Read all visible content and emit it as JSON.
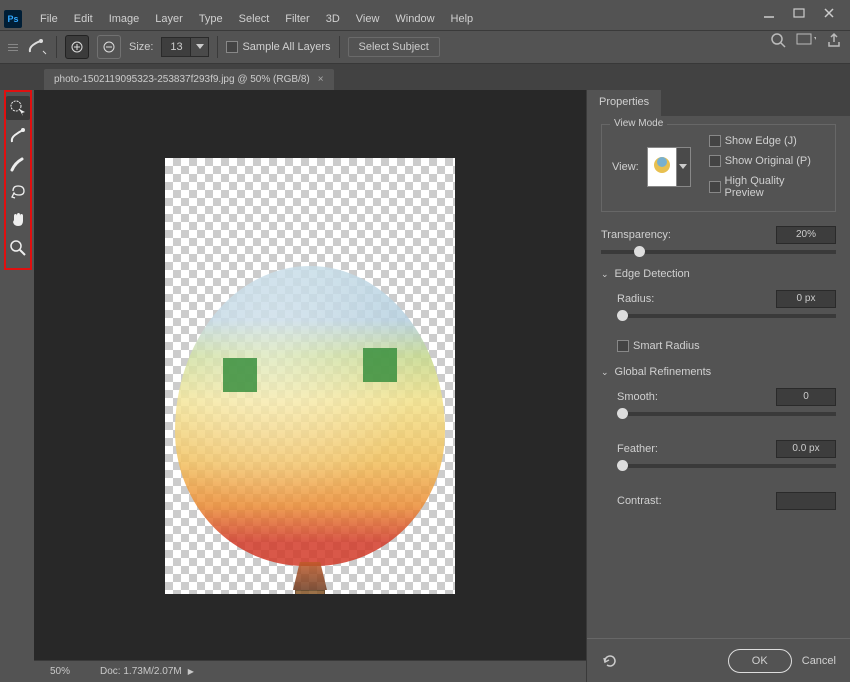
{
  "menu": [
    "File",
    "Edit",
    "Image",
    "Layer",
    "Type",
    "Select",
    "Filter",
    "3D",
    "View",
    "Window",
    "Help"
  ],
  "options": {
    "size_label": "Size:",
    "size_value": "13",
    "sample_all": "Sample All Layers",
    "select_subject": "Select Subject"
  },
  "doc_tab": {
    "title": "photo-1502119095323-253837f293f9.jpg @ 50% (RGB/8)"
  },
  "status": {
    "zoom": "50%",
    "doc_size": "Doc: 1.73M/2.07M"
  },
  "panel": {
    "title": "Properties",
    "view_mode": {
      "legend": "View Mode",
      "view_label": "View:",
      "show_edge": "Show Edge (J)",
      "show_original": "Show Original (P)",
      "high_quality": "High Quality Preview"
    },
    "transparency": {
      "label": "Transparency:",
      "value": "20%",
      "pos": "14%"
    },
    "edge_detection": {
      "title": "Edge Detection",
      "radius_label": "Radius:",
      "radius_value": "0 px",
      "smart_radius": "Smart Radius"
    },
    "global": {
      "title": "Global Refinements",
      "smooth_label": "Smooth:",
      "smooth_value": "0",
      "feather_label": "Feather:",
      "feather_value": "0.0 px",
      "contrast_label": "Contrast:"
    },
    "footer": {
      "ok": "OK",
      "cancel": "Cancel"
    }
  }
}
